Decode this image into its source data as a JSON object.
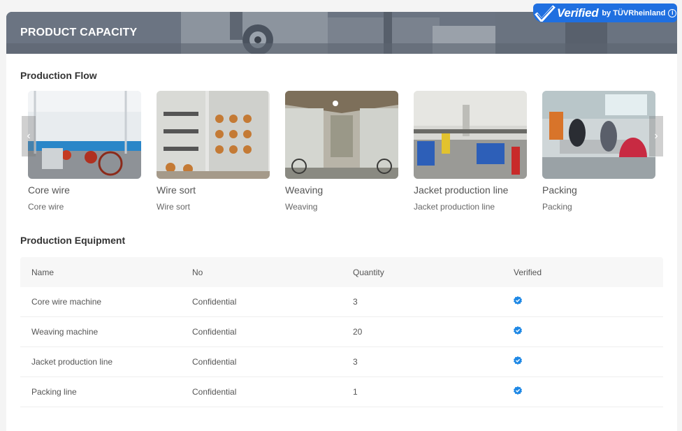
{
  "badge": {
    "word": "Verified",
    "by": "by TÜVRheinland",
    "info": "i"
  },
  "header": {
    "title": "PRODUCT CAPACITY"
  },
  "flow": {
    "title": "Production Flow",
    "items": [
      {
        "name": "Core wire",
        "sub": "Core wire"
      },
      {
        "name": "Wire sort",
        "sub": "Wire sort"
      },
      {
        "name": "Weaving",
        "sub": "Weaving"
      },
      {
        "name": "Jacket production line",
        "sub": "Jacket production line"
      },
      {
        "name": "Packing",
        "sub": "Packing"
      }
    ],
    "prev_arrow": "‹",
    "next_arrow": "›"
  },
  "equipment": {
    "title": "Production Equipment",
    "columns": [
      "Name",
      "No",
      "Quantity",
      "Verified"
    ],
    "rows": [
      {
        "name": "Core wire machine",
        "no": "Confidential",
        "quantity": "3"
      },
      {
        "name": "Weaving machine",
        "no": "Confidential",
        "quantity": "20"
      },
      {
        "name": "Jacket production line",
        "no": "Confidential",
        "quantity": "3"
      },
      {
        "name": "Packing line",
        "no": "Confidential",
        "quantity": "1"
      }
    ]
  },
  "colors": {
    "badge_blue": "#1f6fe0",
    "verified_icon": "#1e88e5"
  }
}
